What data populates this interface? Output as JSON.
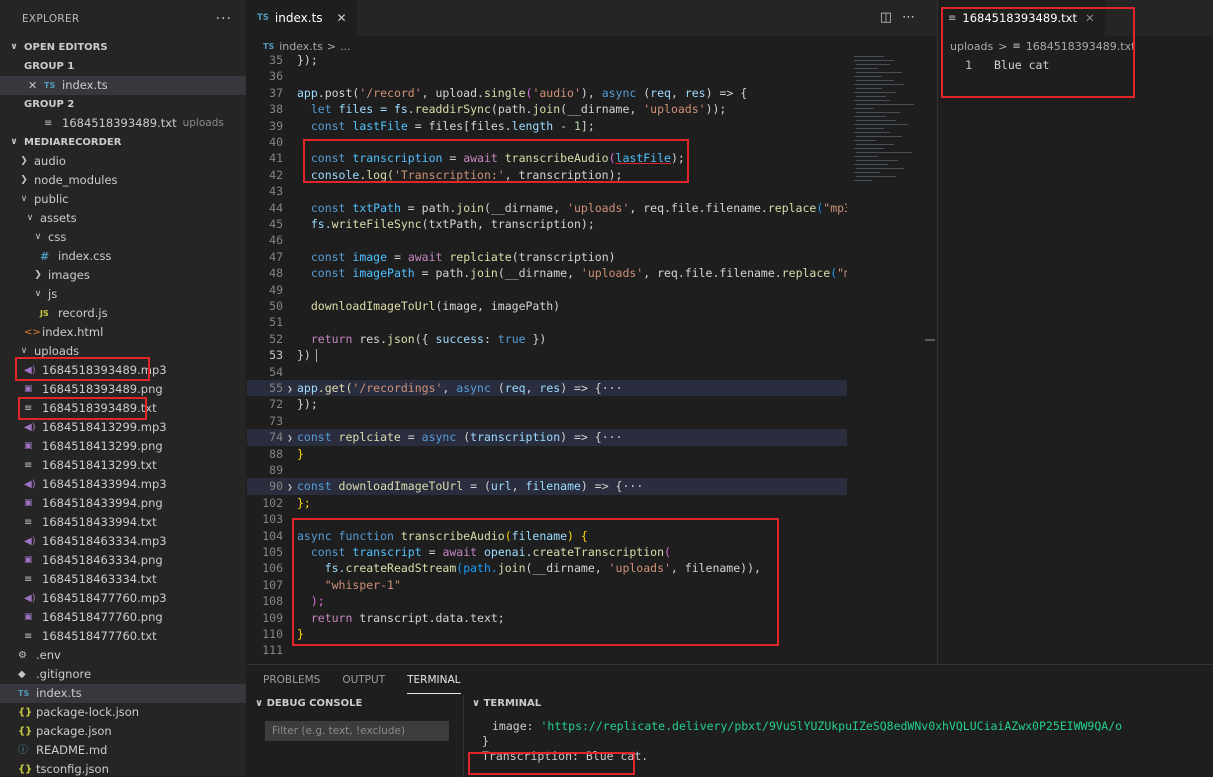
{
  "explorer": {
    "title": "EXPLORER",
    "more": "···",
    "open_editors": "OPEN EDITORS",
    "group1": "GROUP 1",
    "group1_file": "index.ts",
    "group2": "GROUP 2",
    "group2_file": "1684518393489.txt",
    "group2_folder": "uploads",
    "project": "MEDIARECORDER",
    "tree": {
      "audio": "audio",
      "node_modules": "node_modules",
      "public": "public",
      "assets": "assets",
      "css": "css",
      "index_css": "index.css",
      "images": "images",
      "js": "js",
      "record_js": "record.js",
      "index_html": "index.html",
      "uploads": "uploads",
      "f1": "1684518393489.mp3",
      "f2": "1684518393489.png",
      "f3": "1684518393489.txt",
      "f4": "1684518413299.mp3",
      "f5": "1684518413299.png",
      "f6": "1684518413299.txt",
      "f7": "1684518433994.mp3",
      "f8": "1684518433994.png",
      "f9": "1684518433994.txt",
      "f10": "1684518463334.mp3",
      "f11": "1684518463334.png",
      "f12": "1684518463334.txt",
      "f13": "1684518477760.mp3",
      "f14": "1684518477760.png",
      "f15": "1684518477760.txt",
      "env": ".env",
      "gitignore": ".gitignore",
      "index_ts": "index.ts",
      "package_lock": "package-lock.json",
      "package": "package.json",
      "readme": "README.md",
      "tsconfig": "tsconfig.json"
    }
  },
  "editor": {
    "tab_label": "index.ts",
    "breadcrumb_file": "index.ts",
    "breadcrumb_more": "...",
    "lines": {
      "n35": "35",
      "n36": "36",
      "n37": "37",
      "n38": "38",
      "n39": "39",
      "n40": "40",
      "n41": "41",
      "n42": "42",
      "n43": "43",
      "n44": "44",
      "n45": "45",
      "n46": "46",
      "n47": "47",
      "n48": "48",
      "n49": "49",
      "n50": "50",
      "n51": "51",
      "n52": "52",
      "n53": "53",
      "n54": "54",
      "n55": "55",
      "n72": "72",
      "n73": "73",
      "n74": "74",
      "n88": "88",
      "n89": "89",
      "n90": "90",
      "n102": "102",
      "n103": "103",
      "n104": "104",
      "n105": "105",
      "n106": "106",
      "n107": "107",
      "n108": "108",
      "n109": "109",
      "n110": "110",
      "n111": "111"
    },
    "code": {
      "l35": "});",
      "l37a": "app",
      "l37b": ".post(",
      "l37c": "'/record'",
      "l37d": ", upload.",
      "l37e": "single",
      "l37f": "(",
      "l37g": "'audio'",
      "l37h": "), ",
      "l37i": "async",
      "l37j": " (",
      "l37k": "req",
      "l37l": ", ",
      "l37m": "res",
      "l37n": ") => {",
      "l38a": "let",
      "l38b": " files = fs.",
      "l38c": "readdirSync",
      "l38d": "(path.",
      "l38e": "join",
      "l38f": "(__dirname, ",
      "l38g": "'uploads'",
      "l38h": "));",
      "l39a": "const",
      "l39b": " lastFile",
      "l39c": " = files[files.",
      "l39d": "length",
      "l39e": " - ",
      "l39f": "1",
      "l39g": "];",
      "l41a": "const",
      "l41b": " transcription",
      "l41c": " = ",
      "l41d": "await",
      "l41e": " transcribeAudio",
      "l41f": "(",
      "l41g": "lastFile",
      "l41h": ");",
      "l42a": "console",
      "l42b": ".log(",
      "l42c": "'Transcription:'",
      "l42d": ", transcription);",
      "l44a": "const",
      "l44b": " txtPath",
      "l44c": " = path.",
      "l44d": "join",
      "l44e": "(__dirname, ",
      "l44f": "'uploads'",
      "l44g": ", req.file.filename.",
      "l44h": "replace",
      "l44i": "(",
      "l44j": "\"mp3\"",
      "l45a": "fs.",
      "l45b": "writeFileSync",
      "l45c": "(txtPath, transcription);",
      "l47a": "const",
      "l47b": " image",
      "l47c": " = ",
      "l47d": "await",
      "l47e": " replciate",
      "l47f": "(transcription)",
      "l48a": "const",
      "l48b": " imagePath",
      "l48c": " = path.",
      "l48d": "join",
      "l48e": "(__dirname, ",
      "l48f": "'uploads'",
      "l48g": ", req.file.filename.",
      "l48h": "replace",
      "l48i": "(",
      "l48j": "\"mp",
      "l50a": "downloadImageToUrl",
      "l50b": "(image, imagePath)",
      "l52a": "return",
      "l52b": " res.",
      "l52c": "json",
      "l52d": "({ ",
      "l52e": "success",
      "l52f": ": ",
      "l52g": "true",
      "l52h": " })",
      "l53": "})",
      "l55a": "app",
      "l55b": ".get(",
      "l55c": "'/recordings'",
      "l55d": ", ",
      "l55e": "async",
      "l55f": " (",
      "l55g": "req",
      "l55h": ", ",
      "l55i": "res",
      "l55j": ") => {",
      "l55k": "···",
      "l72": "});",
      "l74a": "const",
      "l74b": " replciate",
      "l74c": " = ",
      "l74d": "async",
      "l74e": " (",
      "l74f": "transcription",
      "l74g": ") => {",
      "l74h": "···",
      "l88": "}",
      "l90a": "const",
      "l90b": " downloadImageToUrl",
      "l90c": " = (",
      "l90d": "url",
      "l90e": ", ",
      "l90f": "filename",
      "l90g": ") => {",
      "l90h": "···",
      "l102": "};",
      "l104a": "async",
      "l104b": " function",
      "l104c": " transcribeAudio",
      "l104d": "(",
      "l104e": "filename",
      "l104f": ") {",
      "l105a": "const",
      "l105b": " transcript",
      "l105c": " = ",
      "l105d": "await",
      "l105e": " openai.",
      "l105f": "createTranscription",
      "l105g": "(",
      "l106a": "fs.",
      "l106b": "createReadStream",
      "l106c": "(path.",
      "l106d": "join",
      "l106e": "(__dirname, ",
      "l106f": "'uploads'",
      "l106g": ", filename)),",
      "l107": "\"whisper-1\"",
      "l108": ");",
      "l109a": "return",
      "l109b": " transcript.data.text;",
      "l110": "}"
    }
  },
  "editor2": {
    "tab_label": "1684518393489.txt",
    "breadcrumb_folder": "uploads",
    "breadcrumb_file": "1684518393489.txt",
    "line_no": "1",
    "content": "Blue cat"
  },
  "panel": {
    "tabs": [
      "PROBLEMS",
      "OUTPUT",
      "TERMINAL"
    ],
    "debug_title": "DEBUG CONSOLE",
    "filter_placeholder": "Filter (e.g. text, !exclude)",
    "terminal_title": "TERMINAL",
    "term_key": "image: ",
    "term_url": "'https://replicate.delivery/pbxt/9VuSlYUZUkpuIZeSQ8edWNv0xhVQLUCiaiAZwx0P25EIWW9QA/o",
    "term_brace": "}",
    "term_transcription": "Transcription: Blue cat."
  }
}
